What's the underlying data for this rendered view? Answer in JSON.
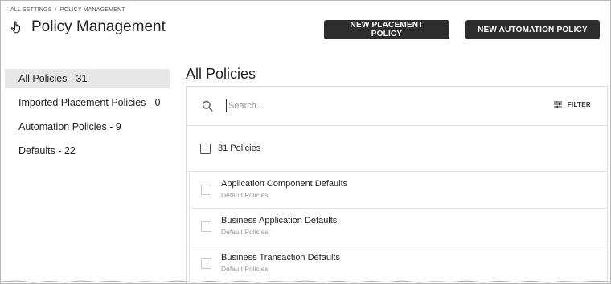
{
  "breadcrumb": {
    "root": "ALL SETTINGS",
    "separator": "/",
    "current": "POLICY MANAGEMENT"
  },
  "header": {
    "title": "Policy Management",
    "icon": "hand-pointer-icon"
  },
  "actions": {
    "new_placement": "NEW PLACEMENT POLICY",
    "new_automation": "NEW AUTOMATION POLICY"
  },
  "sidebar": {
    "items": [
      {
        "label": "All Policies - 31",
        "active": true
      },
      {
        "label": "Imported Placement Policies - 0",
        "active": false
      },
      {
        "label": "Automation Policies - 9",
        "active": false
      },
      {
        "label": "Defaults - 22",
        "active": false
      }
    ]
  },
  "main": {
    "title": "All Policies",
    "search": {
      "placeholder": "Search...",
      "value": ""
    },
    "filter_label": "FILTER",
    "count_label": "31 Policies",
    "rows": [
      {
        "name": "Application Component Defaults",
        "type": "Default Policies"
      },
      {
        "name": "Business Application Defaults",
        "type": "Default Policies"
      },
      {
        "name": "Business Transaction Defaults",
        "type": "Default Policies"
      }
    ]
  },
  "colors": {
    "button_bg": "#2d2d2d",
    "active_bg": "#e7e7e7",
    "subtext": "#999999"
  }
}
